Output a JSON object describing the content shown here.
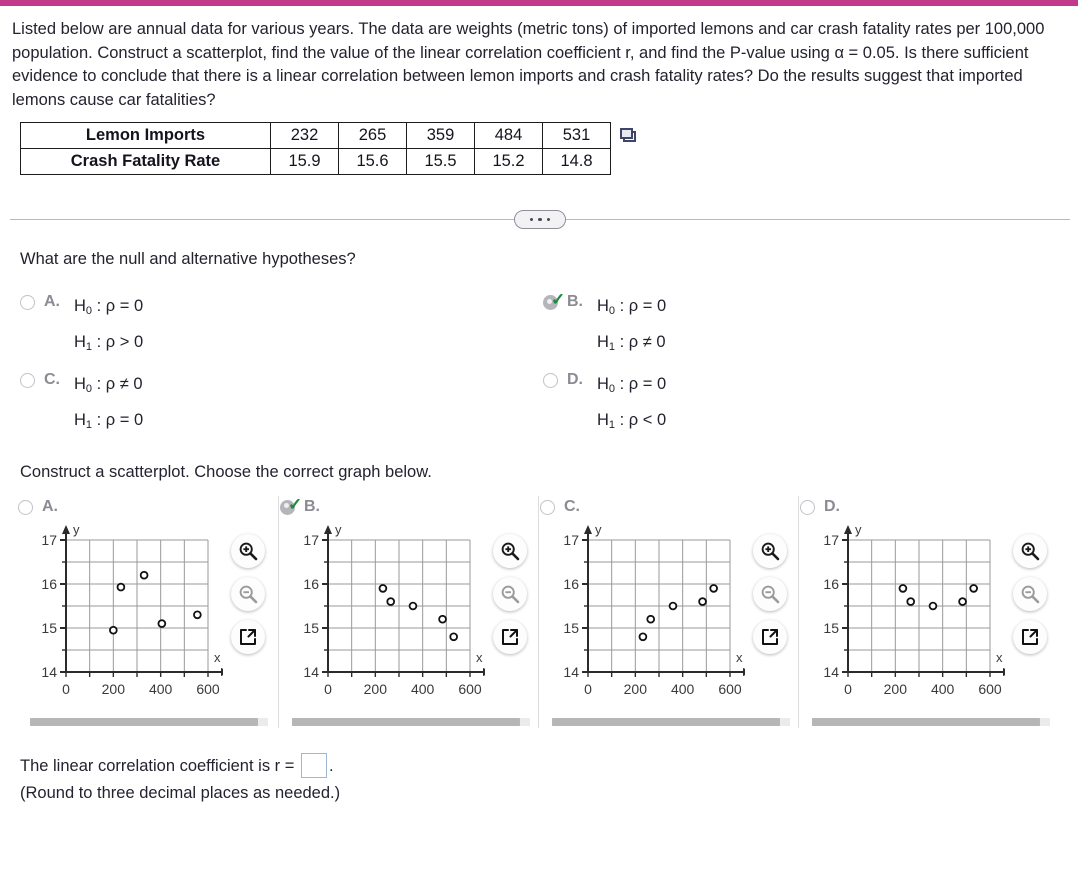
{
  "prompt": "Listed below are annual data for various years. The data are weights (metric tons) of imported lemons and car crash fatality rates per 100,000 population. Construct a scatterplot, find the value of the linear correlation coefficient r, and find the P-value using α = 0.05. Is there sufficient evidence to conclude that there is a linear correlation between lemon imports and crash fatality rates? Do the results suggest that imported lemons cause car fatalities?",
  "table": {
    "rows": [
      {
        "label": "Lemon Imports",
        "values": [
          "232",
          "265",
          "359",
          "484",
          "531"
        ]
      },
      {
        "label": "Crash Fatality Rate",
        "values": [
          "15.9",
          "15.6",
          "15.5",
          "15.2",
          "14.8"
        ]
      }
    ],
    "copy_icon": "copy-icon"
  },
  "divider": {
    "icon": "ellipsis-icon",
    "dots": 3
  },
  "hypothesis_question": "What are the null and alternative hypotheses?",
  "hypothesis_options": [
    {
      "letter": "A.",
      "null": "H0 : ρ = 0",
      "alt": "H1 : ρ > 0",
      "selected": false
    },
    {
      "letter": "B.",
      "null": "H0 : ρ = 0",
      "alt": "H1 : ρ ≠ 0",
      "selected": true
    },
    {
      "letter": "C.",
      "null": "H0 : ρ ≠ 0",
      "alt": "H1 : ρ = 0",
      "selected": false
    },
    {
      "letter": "D.",
      "null": "H0 : ρ = 0",
      "alt": "H1 : ρ < 0",
      "selected": false
    }
  ],
  "scatter_question": "Construct a scatterplot. Choose the correct graph below.",
  "graph_options": [
    {
      "letter": "A.",
      "selected": false
    },
    {
      "letter": "B.",
      "selected": true
    },
    {
      "letter": "C.",
      "selected": false
    },
    {
      "letter": "D.",
      "selected": false
    }
  ],
  "graph_tools": {
    "zoom_in": "zoom-in-icon",
    "zoom_out": "zoom-out-icon",
    "expand": "expand-icon"
  },
  "answer": {
    "text_before": "The linear correlation coefficient is r =",
    "text_after": ".",
    "input_value": "",
    "note": "(Round to three decimal places as needed.)"
  },
  "chart_data": [
    {
      "type": "scatter",
      "label": "A",
      "title": "",
      "xlabel": "x",
      "ylabel": "y",
      "xlim": [
        0,
        650
      ],
      "ylim": [
        14,
        17
      ],
      "xticks": [
        0,
        200,
        400,
        600
      ],
      "yticks": [
        14,
        15,
        16,
        17
      ],
      "grid": true,
      "points": [
        {
          "x": 200,
          "y": 14.95
        },
        {
          "x": 232,
          "y": 15.93
        },
        {
          "x": 330,
          "y": 16.2
        },
        {
          "x": 405,
          "y": 15.1
        },
        {
          "x": 555,
          "y": 15.3
        }
      ]
    },
    {
      "type": "scatter",
      "label": "B",
      "title": "",
      "xlabel": "x",
      "ylabel": "y",
      "xlim": [
        0,
        650
      ],
      "ylim": [
        14,
        17
      ],
      "xticks": [
        0,
        200,
        400,
        600
      ],
      "yticks": [
        14,
        15,
        16,
        17
      ],
      "grid": true,
      "points": [
        {
          "x": 232,
          "y": 15.9
        },
        {
          "x": 265,
          "y": 15.6
        },
        {
          "x": 359,
          "y": 15.5
        },
        {
          "x": 484,
          "y": 15.2
        },
        {
          "x": 531,
          "y": 14.8
        }
      ]
    },
    {
      "type": "scatter",
      "label": "C",
      "title": "",
      "xlabel": "x",
      "ylabel": "y",
      "xlim": [
        0,
        650
      ],
      "ylim": [
        14,
        17
      ],
      "xticks": [
        0,
        200,
        400,
        600
      ],
      "yticks": [
        14,
        15,
        16,
        17
      ],
      "grid": true,
      "points": [
        {
          "x": 232,
          "y": 14.8
        },
        {
          "x": 265,
          "y": 15.2
        },
        {
          "x": 359,
          "y": 15.5
        },
        {
          "x": 484,
          "y": 15.6
        },
        {
          "x": 531,
          "y": 15.9
        }
      ]
    },
    {
      "type": "scatter",
      "label": "D",
      "title": "",
      "xlabel": "x",
      "ylabel": "y",
      "xlim": [
        0,
        650
      ],
      "ylim": [
        14,
        17
      ],
      "xticks": [
        0,
        200,
        400,
        600
      ],
      "yticks": [
        14,
        15,
        16,
        17
      ],
      "grid": true,
      "points": [
        {
          "x": 232,
          "y": 15.9
        },
        {
          "x": 265,
          "y": 15.6
        },
        {
          "x": 359,
          "y": 15.5
        },
        {
          "x": 484,
          "y": 15.6
        },
        {
          "x": 531,
          "y": 15.9
        }
      ]
    }
  ]
}
